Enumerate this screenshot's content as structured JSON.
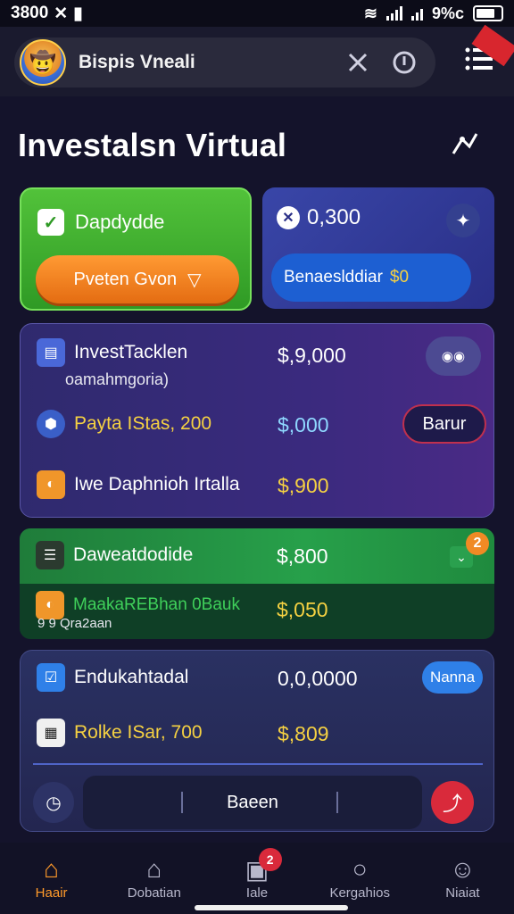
{
  "statusbar": {
    "time": "3800",
    "battery": "9%c"
  },
  "appbar": {
    "title": "Bispis Vneali"
  },
  "section": {
    "title": "Investalsn Virtual"
  },
  "card_green": {
    "label": "Dapdydde",
    "button": "Pveten Gvon"
  },
  "card_blue": {
    "value": "0,300",
    "pill_label": "Benaeslddiar",
    "pill_value": "$0"
  },
  "card_purple": {
    "rows": [
      {
        "label": "InvestTacklen",
        "sub": "oamahmgoria)",
        "amount": "$,9,000"
      },
      {
        "label": "Payta IStas, 200",
        "amount": "$,000",
        "button": "Barur"
      },
      {
        "label": "Iwe Daphnioh Irtalla",
        "amount": "$,900"
      }
    ]
  },
  "card_green2": {
    "rows": [
      {
        "label": "Daweatdodide",
        "amount": "$,800"
      },
      {
        "label": "MaakaREBhan 0Bauk",
        "sub": "9 9 Qra2aan",
        "amount": "$,050"
      }
    ],
    "badge": "2"
  },
  "card_navy": {
    "rows": [
      {
        "label": "Endukahtadal",
        "amount": "0,0,0000",
        "tag": "Nanna"
      },
      {
        "label": "Rolke ISar, 700",
        "amount": "$,809"
      }
    ],
    "field_text": "Baeen"
  },
  "navbar": {
    "items": [
      {
        "label": "Haair",
        "icon": "home-icon"
      },
      {
        "label": "Dobatian",
        "icon": "store-icon"
      },
      {
        "label": "Iale",
        "icon": "wallet-icon",
        "badge": "2"
      },
      {
        "label": "Kergahios",
        "icon": "search-icon"
      },
      {
        "label": "Niaiat",
        "icon": "profile-icon"
      }
    ]
  },
  "colors": {
    "accent": "#ff9a2a",
    "green": "#2f9a25",
    "blue": "#1d5fd2",
    "red": "#d92a3b",
    "gold": "#f5d142",
    "background": "#14132b"
  }
}
